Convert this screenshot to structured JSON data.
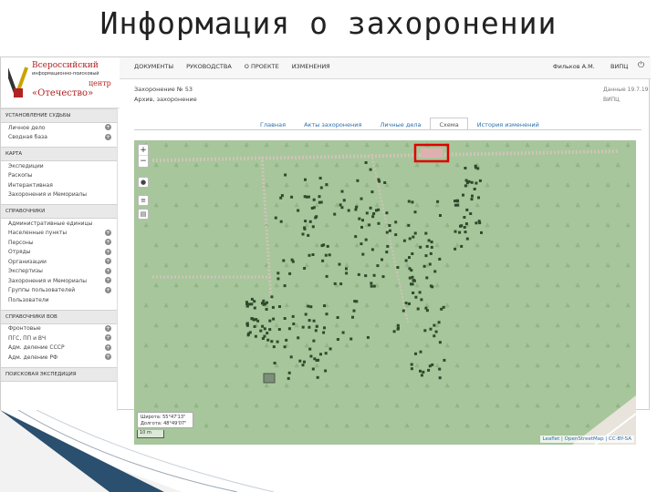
{
  "slide": {
    "title": "Информация о захоронении"
  },
  "logo": {
    "line1": "Всероссийский",
    "line2": "информационно-поисковый",
    "line3": "центр",
    "line4": "«Отечество»"
  },
  "nav": {
    "items": [
      "ДОКУМЕНТЫ",
      "РУКОВОДСТВА",
      "О ПРОЕКТЕ",
      "ИЗМЕНЕНИЯ"
    ],
    "user": "Фильков А.М.",
    "org": "ВИПЦ"
  },
  "header": {
    "line1": "Захоронение № 53",
    "line2": "Архив, захоронение",
    "right1": "Данные 19.7.19",
    "right2": "ВИПЦ"
  },
  "sidebar": {
    "sections": [
      {
        "title": "Установление судьбы",
        "items": [
          {
            "label": "Личное дело",
            "plus": true
          },
          {
            "label": "Сводная база",
            "plus": true
          }
        ]
      },
      {
        "title": "Карта",
        "items": [
          {
            "label": "Экспедиции",
            "plus": false
          },
          {
            "label": "Раскопы",
            "plus": false
          },
          {
            "label": "Интерактивная",
            "plus": false
          },
          {
            "label": "Захоронения и Мемориалы",
            "plus": false
          }
        ]
      },
      {
        "title": "Справочники",
        "items": [
          {
            "label": "Административные единицы",
            "plus": false
          },
          {
            "label": "Населенные пункты",
            "plus": true
          },
          {
            "label": "Персоны",
            "plus": true
          },
          {
            "label": "Отряды",
            "plus": true
          },
          {
            "label": "Организации",
            "plus": true
          },
          {
            "label": "Экспертизы",
            "plus": true
          },
          {
            "label": "Захоронения и Мемориалы",
            "plus": true
          },
          {
            "label": "Группы пользователей",
            "plus": true
          },
          {
            "label": "Пользователи",
            "plus": false
          }
        ]
      },
      {
        "title": "Справочники ВОВ",
        "items": [
          {
            "label": "Фронтовые",
            "plus": true
          },
          {
            "label": "ПГС, ПП и ВЧ",
            "plus": true
          },
          {
            "label": "Адм. деление СССР",
            "plus": true
          },
          {
            "label": "Адм. деление РФ",
            "plus": true
          }
        ]
      },
      {
        "title": "Поисковая экспедиция",
        "items": []
      }
    ]
  },
  "tabs": {
    "items": [
      "Главная",
      "Акты захоронения",
      "Личные дела",
      "Схема",
      "История изменений"
    ],
    "active": 3
  },
  "map": {
    "zoom_in": "+",
    "zoom_out": "−",
    "coords_line1": "Широта: 55°47'13\"",
    "coords_line2": "Долгота: 48°49'07\"",
    "scale": "10 m",
    "attribution": "Leaflet | OpenStreetMap | CC-BY-SA",
    "bg_color": "#a7c69c",
    "highlight_color": "#e00000"
  }
}
